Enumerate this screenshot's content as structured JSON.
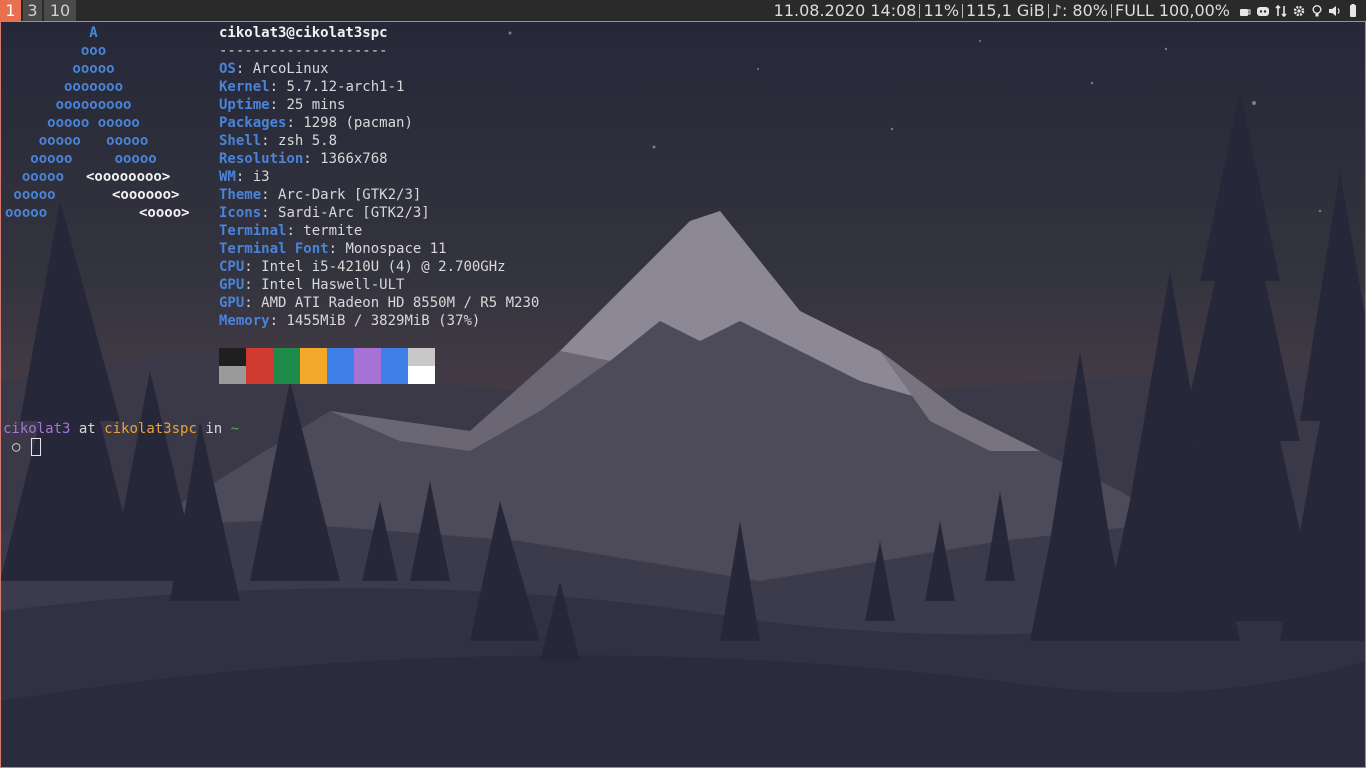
{
  "workspaces": [
    {
      "label": "1",
      "active": true
    },
    {
      "label": "3",
      "active": false
    },
    {
      "label": "10",
      "active": false
    }
  ],
  "status": {
    "datetime": "11.08.2020 14:08",
    "cpu": "11%",
    "disk": "115,1 GiB",
    "volume": "♪: 80%",
    "battery": "FULL 100,00%"
  },
  "tray_icons": [
    "coffee-icon",
    "discord-icon",
    "network-transfer-icon",
    "gear-icon",
    "lightbulb-icon",
    "volume-icon",
    "battery-icon"
  ],
  "ascii_logo": [
    "          A",
    "         ooo",
    "        ooooo",
    "       ooooooo",
    "      ooooooooo",
    "     ooooo ooooo",
    "    ooooo   ooooo",
    "   ooooo     ooooo",
    "  ooooo  ",
    " ooooo       ",
    "ooooo          "
  ],
  "ascii_logo_accent": [
    "",
    "",
    "",
    "",
    "",
    "",
    "",
    "",
    "<oooooooo>",
    "<oooooo>",
    "<oooo>"
  ],
  "neofetch": {
    "header": "cikolat3@cikolat3spc",
    "separator": "--------------------",
    "rows": [
      {
        "key": "OS",
        "value": "ArcoLinux"
      },
      {
        "key": "Kernel",
        "value": "5.7.12-arch1-1"
      },
      {
        "key": "Uptime",
        "value": "25 mins"
      },
      {
        "key": "Packages",
        "value": "1298 (pacman)"
      },
      {
        "key": "Shell",
        "value": "zsh 5.8"
      },
      {
        "key": "Resolution",
        "value": "1366x768"
      },
      {
        "key": "WM",
        "value": "i3"
      },
      {
        "key": "Theme",
        "value": "Arc-Dark [GTK2/3]"
      },
      {
        "key": "Icons",
        "value": "Sardi-Arc [GTK2/3]"
      },
      {
        "key": "Terminal",
        "value": "termite"
      },
      {
        "key": "Terminal Font",
        "value": "Monospace 11"
      },
      {
        "key": "CPU",
        "value": "Intel i5-4210U (4) @ 2.700GHz"
      },
      {
        "key": "GPU",
        "value": "Intel Haswell-ULT"
      },
      {
        "key": "GPU",
        "value": "AMD ATI Radeon HD 8550M / R5 M230"
      },
      {
        "key": "Memory",
        "value": "1455MiB / 3829MiB (37%)"
      }
    ],
    "palette_top": [
      "#1f1f1f",
      "#d03a30",
      "#1e8a4a",
      "#f4a82a",
      "#3f80e8",
      "#a672d4",
      "#3f80e8",
      "#c8c8c8"
    ],
    "palette_bottom": [
      "#9a9a9a",
      "#d03a30",
      "#1e8a4a",
      "#f4a82a",
      "#3f80e8",
      "#a672d4",
      "#3f80e8",
      "#ffffff"
    ]
  },
  "prompt": {
    "user": "cikolat3",
    "at": "at",
    "host": "cikolat3spc",
    "in": "in",
    "dir": "~",
    "symbol": "○"
  }
}
